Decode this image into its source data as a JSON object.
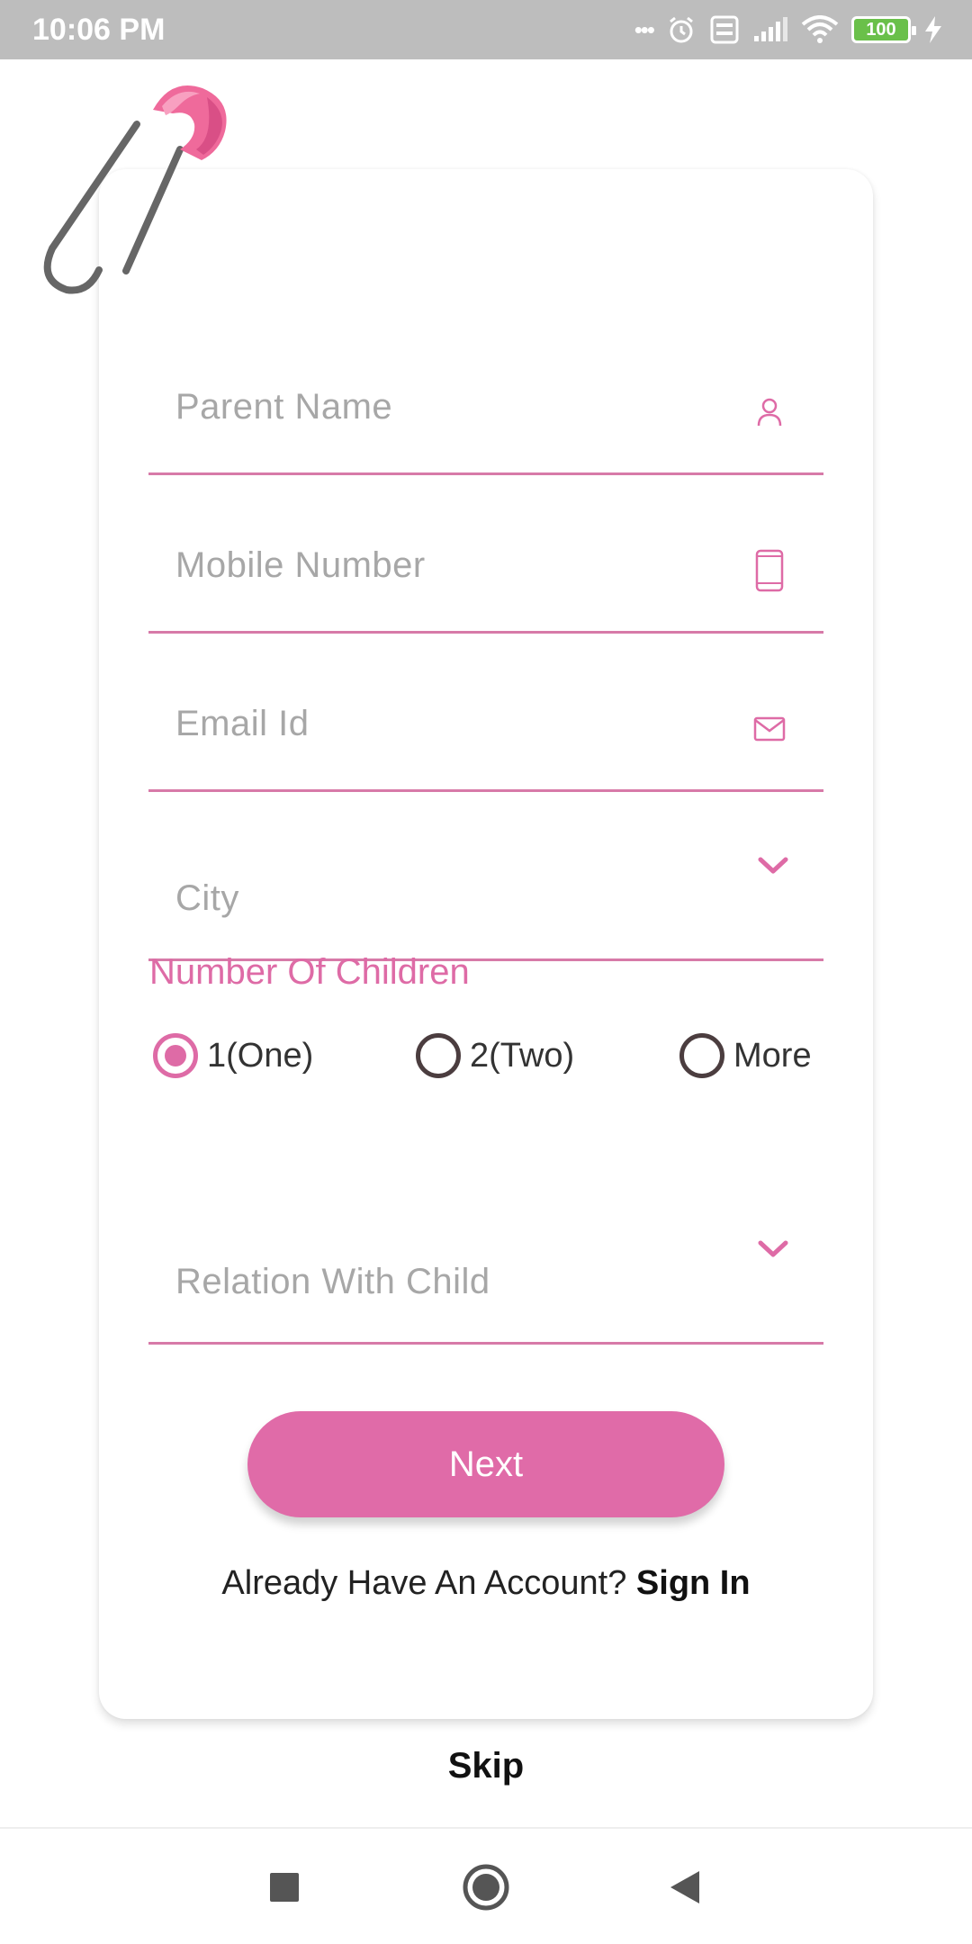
{
  "status_bar": {
    "time": "10:06 PM",
    "dots": "•••",
    "battery": "100"
  },
  "form": {
    "parent_name": {
      "placeholder": "Parent Name",
      "icon": "person-icon"
    },
    "mobile_number": {
      "placeholder": "Mobile Number",
      "icon": "phone-icon"
    },
    "email": {
      "placeholder": "Email Id",
      "icon": "mail-icon"
    },
    "city": {
      "placeholder": "City",
      "icon": "chevron-down-icon"
    },
    "children_label": "Number Of Children",
    "children_options": [
      {
        "label": "1(One)",
        "selected": true
      },
      {
        "label": "2(Two)",
        "selected": false
      },
      {
        "label": "More",
        "selected": false
      }
    ],
    "relation": {
      "placeholder": "Relation With Child",
      "icon": "chevron-down-icon"
    }
  },
  "actions": {
    "next_label": "Next",
    "account_prompt": "Already Have An Account? ",
    "sign_in_label": "Sign In",
    "skip_label": "Skip"
  },
  "colors": {
    "accent": "#de6ba6",
    "button": "#e06ba8",
    "placeholder": "#a7a7a7",
    "status_bar": "#bdbdbd"
  },
  "navigation": {
    "buttons": [
      "recent-apps-icon",
      "home-icon",
      "back-icon"
    ]
  }
}
